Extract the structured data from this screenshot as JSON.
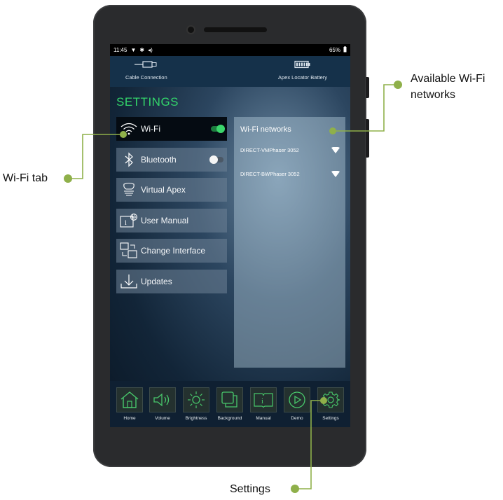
{
  "colors": {
    "accent_green": "#33d46a",
    "callout_green": "#8fb04a",
    "icon_green": "#48c76b"
  },
  "status_bar": {
    "time": "11:45",
    "battery": "65%",
    "icons": [
      "wifi-icon",
      "bluetooth-icon",
      "volume-icon",
      "battery-icon"
    ]
  },
  "connection_bar": {
    "left_label": "Cable Connection",
    "right_label": "Apex Locator Battery"
  },
  "settings_title": "SETTINGS",
  "menu": [
    {
      "label": "Wi-Fi",
      "icon": "wifi-icon",
      "toggle": "on"
    },
    {
      "label": "Bluetooth",
      "icon": "bluetooth-icon",
      "toggle": "off"
    },
    {
      "label": "Virtual Apex",
      "icon": "tooth-icon"
    },
    {
      "label": "User Manual",
      "icon": "manual-icon"
    },
    {
      "label": "Change Interface",
      "icon": "change-interface-icon"
    },
    {
      "label": "Updates",
      "icon": "download-icon"
    }
  ],
  "wifi_panel": {
    "title": "Wi-Fi networks",
    "networks": [
      "DIRECT-VMPhaser 3052",
      "DIRECT-BWPhaser 3052"
    ]
  },
  "dock": [
    {
      "label": "Home",
      "icon": "home-icon"
    },
    {
      "label": "Volume",
      "icon": "volume-icon"
    },
    {
      "label": "Brightness",
      "icon": "brightness-icon"
    },
    {
      "label": "Background",
      "icon": "background-icon"
    },
    {
      "label": "Manual",
      "icon": "manual-icon"
    },
    {
      "label": "Demo",
      "icon": "play-icon"
    },
    {
      "label": "Settings",
      "icon": "gear-icon"
    }
  ],
  "annotations": {
    "wifi_tab": "Wi-Fi tab",
    "available_networks_line1": "Available Wi-Fi",
    "available_networks_line2": "networks",
    "settings": "Settings"
  }
}
